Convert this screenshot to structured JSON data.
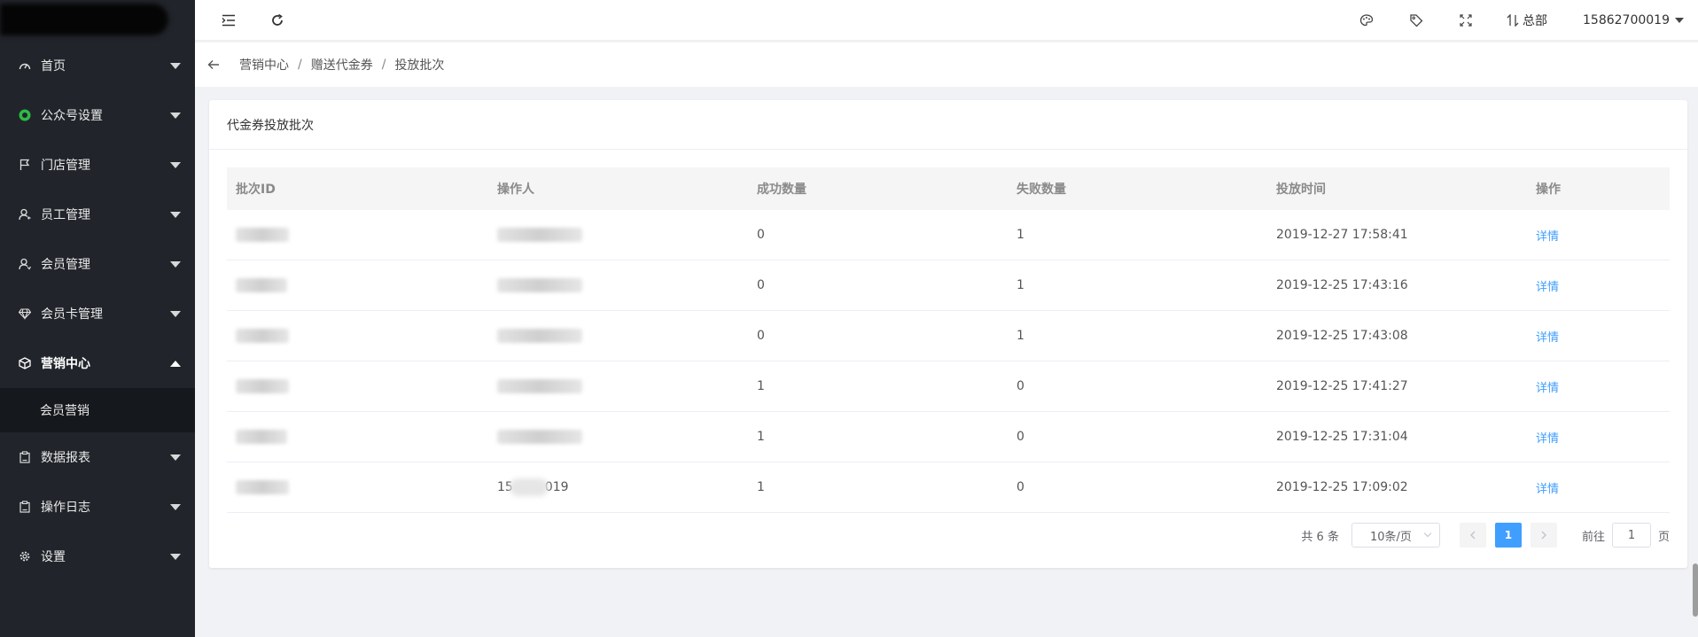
{
  "sidebar": {
    "items": [
      {
        "label": "首页",
        "icon": "dashboard-icon"
      },
      {
        "label": "公众号设置",
        "icon": "wechat-icon"
      },
      {
        "label": "门店管理",
        "icon": "flag-icon"
      },
      {
        "label": "员工管理",
        "icon": "staff-icon"
      },
      {
        "label": "会员管理",
        "icon": "member-icon"
      },
      {
        "label": "会员卡管理",
        "icon": "diamond-icon"
      },
      {
        "label": "营销中心",
        "icon": "box-icon"
      },
      {
        "label": "数据报表",
        "icon": "clipboard-icon"
      },
      {
        "label": "操作日志",
        "icon": "clipboard-icon"
      },
      {
        "label": "设置",
        "icon": "gear-icon"
      }
    ],
    "submenu": {
      "label": "会员营销"
    }
  },
  "header": {
    "hq_label": "总部",
    "user": "15862700019"
  },
  "breadcrumb": [
    "营销中心",
    "赠送代金券",
    "投放批次"
  ],
  "card": {
    "title": "代金券投放批次"
  },
  "table": {
    "columns": [
      "批次ID",
      "操作人",
      "成功数量",
      "失败数量",
      "投放时间",
      "操作"
    ],
    "rows": [
      {
        "success": "0",
        "fail": "1",
        "time": "2019-12-27 17:58:41",
        "action": "详情"
      },
      {
        "success": "0",
        "fail": "1",
        "time": "2019-12-25 17:43:16",
        "action": "详情"
      },
      {
        "success": "0",
        "fail": "1",
        "time": "2019-12-25 17:43:08",
        "action": "详情"
      },
      {
        "success": "1",
        "fail": "0",
        "time": "2019-12-25 17:41:27",
        "action": "详情"
      },
      {
        "success": "1",
        "fail": "0",
        "time": "2019-12-25 17:31:04",
        "action": "详情"
      },
      {
        "success": "1",
        "fail": "0",
        "time": "2019-12-25 17:09:02",
        "action": "详情",
        "operator_prefix": "15",
        "operator_suffix": "019"
      }
    ]
  },
  "pagination": {
    "total": "共 6 条",
    "page_size": "10条/页",
    "current_page": "1",
    "goto_label": "前往",
    "goto_value": "1",
    "page_unit": "页"
  },
  "colors": {
    "sidebar_bg": "#21252b",
    "accent": "#409eff",
    "wechat_green": "#2dbb45"
  }
}
